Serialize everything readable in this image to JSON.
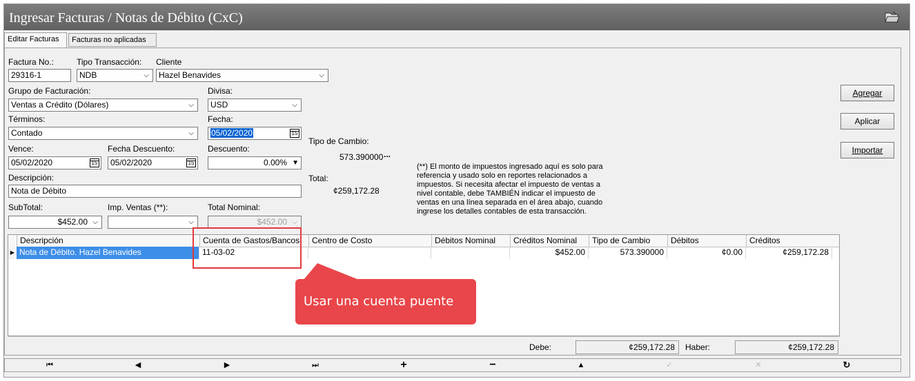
{
  "window": {
    "title": "Ingresar Facturas / Notas de Débito (CxC)",
    "title_icon": "open-folder-icon"
  },
  "tabs": [
    {
      "label": "Editar Facturas",
      "active": true
    },
    {
      "label": "Facturas no aplicadas",
      "active": false
    }
  ],
  "form": {
    "factura_label": "Factura No.:",
    "factura_value": "29316-1",
    "tipo_label": "Tipo Transacción:",
    "tipo_value": "NDB",
    "cliente_label": "Cliente",
    "cliente_value": "Hazel Benavides",
    "grupo_label": "Grupo de Facturación:",
    "grupo_value": "Ventas a Crédito (Dólares)",
    "divisa_label": "Divisa:",
    "divisa_value": "USD",
    "terminos_label": "Términos:",
    "terminos_value": "Contado",
    "fecha_label": "Fecha:",
    "fecha_value": "05/02/2020",
    "vence_label": "Vence:",
    "vence_value": "05/02/2020",
    "fecha_desc_label": "Fecha Descuento:",
    "fecha_desc_value": "05/02/2020",
    "descuento_label": "Descuento:",
    "descuento_value": "0.00%",
    "descripcion_label": "Descripción:",
    "descripcion_value": "Nota de Débito",
    "subtotal_label": "SubTotal:",
    "subtotal_value": "$452.00",
    "imp_label": "Imp. Ventas (**):",
    "imp_value": "",
    "total_label": "Total Nominal:",
    "total_value": "$452.00",
    "tipo_cambio_label": "Tipo de Cambio:",
    "tipo_cambio_value": "573.390000",
    "tipo_cambio_ellipsis": "...",
    "total_side_label": "Total:",
    "total_side_value": "¢259,172.28",
    "note": "(**) El monto de impuestos ingresado aquí es solo para referencia y usado solo en reportes relacionados a impuestos. Si necesita afectar el impuesto de ventas a nivel contable, debe TAMBIÉN indicar el impuesto de ventas en una línea separada en el área abajo, cuando ingrese los detalles contables de esta transacción."
  },
  "buttons": {
    "agregar": "Agregar",
    "aplicar": "Aplicar",
    "importar": "Importar"
  },
  "grid": {
    "headers": [
      "Descripción",
      "Cuenta de Gastos/Bancos",
      "Centro de Costo",
      "Débitos Nominal",
      "Créditos Nominal",
      "Tipo de Cambio",
      "Débitos",
      "Créditos"
    ],
    "rows": [
      [
        "Nota de Débito. Hazel Benavides",
        "11-03-02",
        "",
        "",
        "$452.00",
        "573.390000",
        "¢0.00",
        "¢259,172.28"
      ]
    ]
  },
  "totals": {
    "debe_label": "Debe:",
    "debe_value": "¢259,172.28",
    "haber_label": "Haber:",
    "haber_value": "¢259,172.28"
  },
  "nav": {
    "first": "⏮",
    "prev": "◀",
    "next": "▶",
    "last": "⏭",
    "add": "+",
    "remove": "−",
    "up": "▲",
    "confirm": "✓",
    "cancel": "✕",
    "refresh": "↻"
  },
  "annotation": {
    "callout_text": "Usar una cuenta puente",
    "color": "#e8464a"
  }
}
